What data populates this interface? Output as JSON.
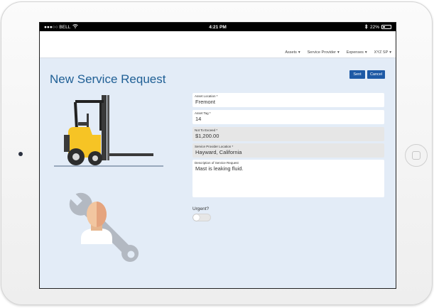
{
  "statusbar": {
    "carrier": "●●●○○ BELL",
    "time": "4:21 PM",
    "battery": "22%",
    "icons": [
      "wifi-icon",
      "bluetooth-icon",
      "battery-icon"
    ]
  },
  "nav": {
    "items": [
      {
        "label": "Assets"
      },
      {
        "label": "Service Provider"
      },
      {
        "label": "Expenses"
      },
      {
        "label": "XYZ SP"
      }
    ],
    "caret": "▾"
  },
  "page": {
    "title": "New Service Request",
    "sent_label": "Sent",
    "cancel_label": "Cancel",
    "accent_color": "#1e5aa6"
  },
  "form": {
    "asset_location": {
      "label": "Asset Location *",
      "value": "Fremont"
    },
    "asset_tag": {
      "label": "Asset Tag *",
      "value": "14"
    },
    "not_to_exceed": {
      "label": "Not To Exceed *",
      "value": "$1,200.00"
    },
    "service_provider_location": {
      "label": "Service Provider Location *",
      "value": "Hayward, California"
    },
    "description": {
      "label": "Description of Service Request",
      "value": "Mast is leaking fluid."
    },
    "urgent": {
      "label": "Urgent?",
      "on": false
    }
  },
  "illustrations": [
    "forklift-illustration",
    "service-technician-wrench-illustration"
  ]
}
